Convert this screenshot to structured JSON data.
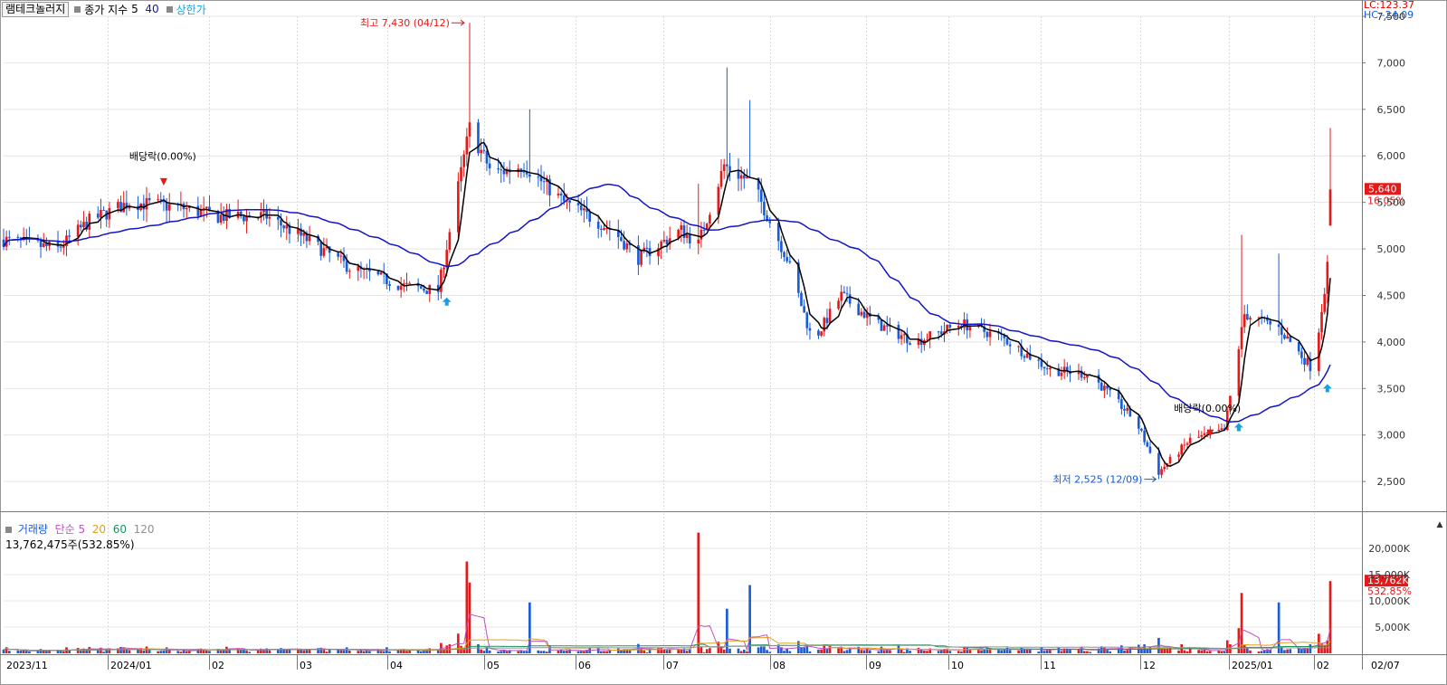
{
  "header": {
    "stock_name": "램테크놀러지",
    "indicator_label": "종가 지수",
    "ma_short": "5",
    "ma_long": "40",
    "limit_label": "상한가"
  },
  "corner": {
    "lc": "LC:123.37",
    "hc": "HC:-24.09"
  },
  "price_axis": {
    "ticks": [
      2500,
      3000,
      3500,
      4000,
      4500,
      5000,
      5500,
      6000,
      6500,
      7000,
      7500
    ],
    "tick_labels": [
      "2,500",
      "3,000",
      "3,500",
      "4,000",
      "4,500",
      "5,000",
      "5,500",
      "6,000",
      "6,500",
      "7,000",
      "7,500"
    ],
    "current_price": "5,640",
    "current_change": "16.05%"
  },
  "annotations": {
    "high": "최고 7,430 (04/12)",
    "low": "최저 2,525 (12/09)",
    "dividend1": "배당락(0.00%)",
    "dividend2": "배당락(0.00%)"
  },
  "volume_header": {
    "label": "거래량",
    "ma_label": "단순",
    "ma1": "5",
    "ma2": "20",
    "ma3": "60",
    "ma4": "120",
    "current": "13,762,475주(532.85%)"
  },
  "volume_axis": {
    "tick_labels": [
      "5,000K",
      "10,000K",
      "15,000K",
      "20,000K"
    ],
    "current_volume": "13,762K",
    "current_change": "532.85%"
  },
  "date_axis": {
    "labels": [
      "2023/11",
      "2024/01",
      "02",
      "03",
      "04",
      "05",
      "06",
      "07",
      "08",
      "09",
      "10",
      "11",
      "12",
      "2025/01",
      "02",
      "02/07"
    ]
  },
  "colors": {
    "up": "#e31a1a",
    "down": "#1a5bd6",
    "ma5": "#000000",
    "ma40": "#1414c8",
    "limit": "#1aa0e0",
    "vol_ma5": "#c050c0",
    "vol_ma20": "#e0a020",
    "vol_ma60": "#209060",
    "vol_ma120": "#909090"
  },
  "chart_data": {
    "type": "candlestick",
    "price_range": [
      2200,
      7500
    ],
    "volume_range": [
      0,
      25000
    ],
    "volume_unit": "K shares",
    "months": [
      "2023/11",
      "2024/01",
      "02",
      "03",
      "04",
      "05",
      "06",
      "07",
      "08",
      "09",
      "10",
      "11",
      "12",
      "2025/01",
      "02"
    ],
    "close_series_approx": [
      [
        "2023-11",
        5100
      ],
      [
        "2023-11-20",
        5000
      ],
      [
        "2023-12-01",
        5300
      ],
      [
        "2023-12-15",
        5500
      ],
      [
        "2024-01",
        5450
      ],
      [
        "2024-01-15",
        5350
      ],
      [
        "2024-02",
        5350
      ],
      [
        "2024-02-15",
        5100
      ],
      [
        "2024-03",
        4800
      ],
      [
        "2024-03-20",
        4600
      ],
      [
        "2024-04-01",
        4550
      ],
      [
        "2024-04-12",
        6300
      ],
      [
        "2024-04-20",
        5800
      ],
      [
        "2024-05-01",
        5900
      ],
      [
        "2024-05-15",
        5500
      ],
      [
        "2024-06-01",
        5200
      ],
      [
        "2024-06-10",
        4900
      ],
      [
        "2024-06-25",
        5200
      ],
      [
        "2024-07-01",
        5050
      ],
      [
        "2024-07-10",
        5900
      ],
      [
        "2024-07-20",
        5700
      ],
      [
        "2024-08-01",
        4900
      ],
      [
        "2024-08-10",
        4000
      ],
      [
        "2024-08-20",
        4500
      ],
      [
        "2024-09-01",
        4200
      ],
      [
        "2024-09-15",
        4000
      ],
      [
        "2024-10-01",
        4200
      ],
      [
        "2024-10-15",
        4050
      ],
      [
        "2024-11-01",
        3700
      ],
      [
        "2024-11-15",
        3650
      ],
      [
        "2024-12-01",
        3150
      ],
      [
        "2024-12-09",
        2600
      ],
      [
        "2024-12-20",
        2950
      ],
      [
        "2025-01-01",
        3050
      ],
      [
        "2025-01-08",
        4300
      ],
      [
        "2025-01-20",
        4150
      ],
      [
        "2025-02-01",
        3700
      ],
      [
        "2025-02-06",
        4800
      ],
      [
        "2025-02-07",
        5640
      ]
    ],
    "high": {
      "value": 7430,
      "date": "04/12"
    },
    "low": {
      "value": 2525,
      "date": "12/09"
    },
    "last": {
      "close": 5640,
      "change_pct": 16.05,
      "volume_k": 13762,
      "volume_change_pct": 532.85
    }
  }
}
